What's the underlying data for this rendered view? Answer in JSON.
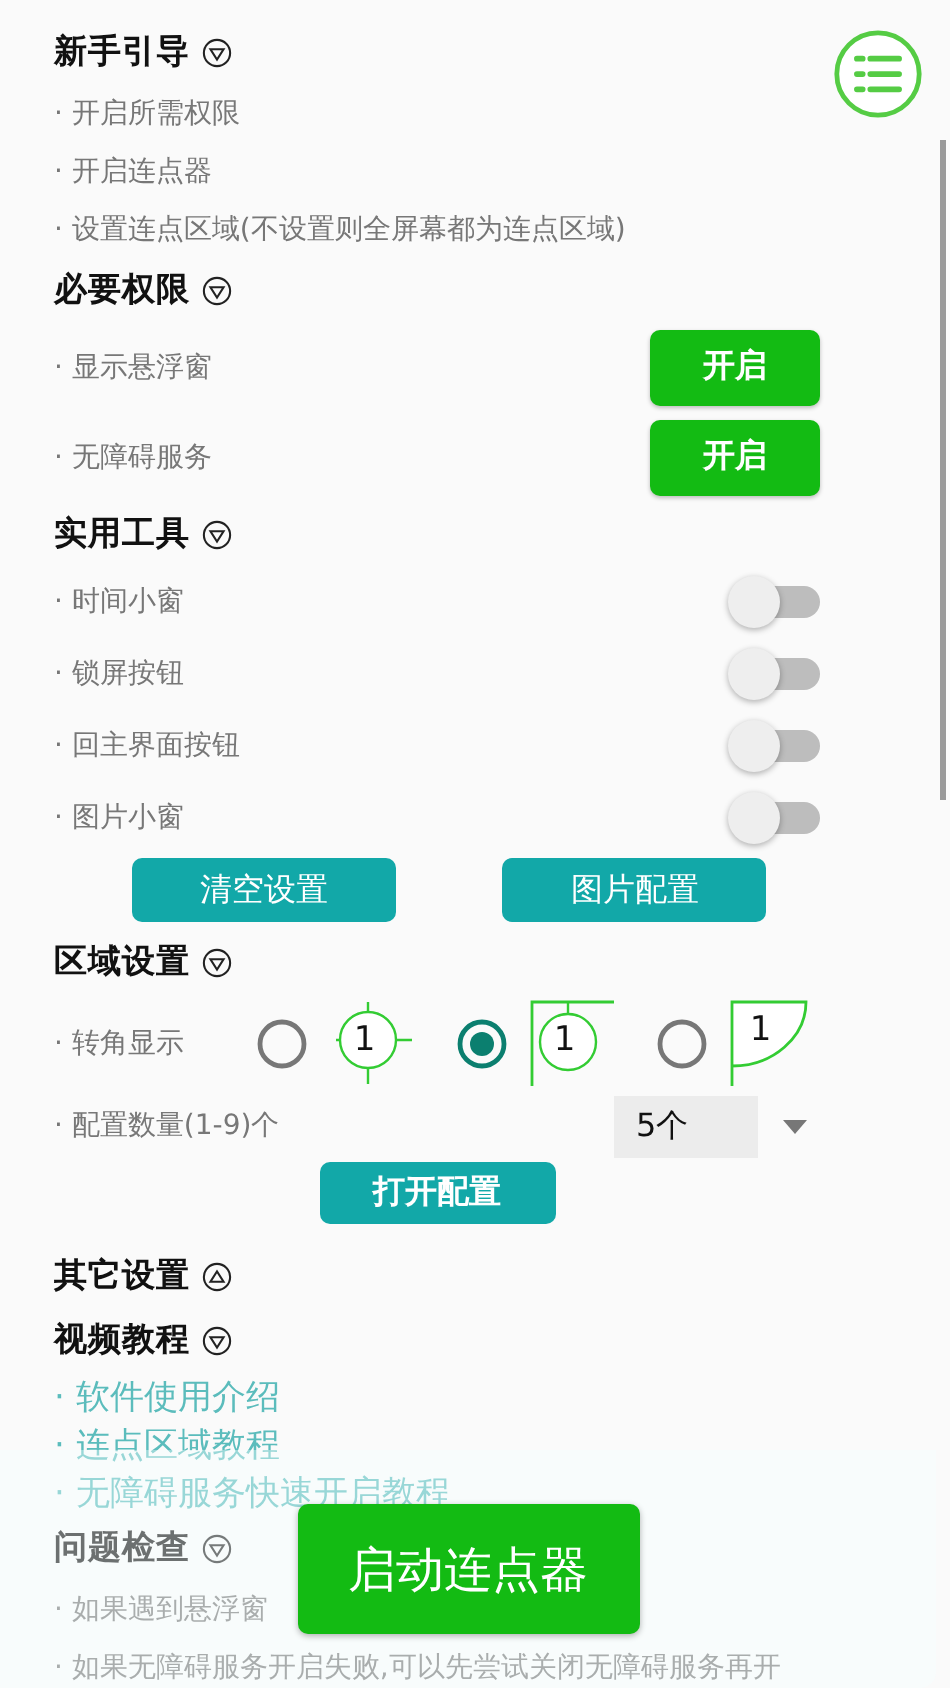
{
  "sections": [
    {
      "kind": "list",
      "title": "新手引导",
      "expanded": true,
      "items": [
        {
          "text": "· 开启所需权限"
        },
        {
          "text": "· 开启连点器"
        },
        {
          "text": "· 设置连点区域(不设置则全屏幕都为连点区域)"
        }
      ]
    },
    {
      "kind": "permissions",
      "title": "必要权限",
      "expanded": true,
      "items": [
        {
          "text": "· 显示悬浮窗",
          "button": "开启"
        },
        {
          "text": "· 无障碍服务",
          "button": "开启"
        }
      ]
    },
    {
      "kind": "toggles",
      "title": "实用工具",
      "expanded": true,
      "items": [
        {
          "text": "· 时间小窗",
          "on": false
        },
        {
          "text": "· 锁屏按钮",
          "on": false
        },
        {
          "text": "· 回主界面按钮",
          "on": false
        },
        {
          "text": "· 图片小窗",
          "on": false
        }
      ],
      "buttons": [
        "清空设置",
        "图片配置"
      ]
    },
    {
      "kind": "area",
      "title": "区域设置",
      "expanded": true,
      "corner": {
        "text": "· 转角显示",
        "options": [
          {
            "kind": "cross",
            "label": "1",
            "selected": false
          },
          {
            "kind": "corner-circle",
            "label": "1",
            "selected": true
          },
          {
            "kind": "quarter",
            "label": "1",
            "selected": false
          }
        ]
      },
      "count": {
        "text": "· 配置数量(1-9)个",
        "value": "5个"
      },
      "button": "打开配置"
    },
    {
      "title": "其它设置",
      "expanded": false
    },
    {
      "kind": "links",
      "title": "视频教程",
      "expanded": true,
      "items": [
        {
          "text": "· 软件使用介绍"
        },
        {
          "text": "· 连点区域教程"
        },
        {
          "text": "· 无障碍服务快速开启教程"
        }
      ]
    },
    {
      "kind": "list",
      "title": "问题检查",
      "expanded": true,
      "items": [
        {
          "text": "· 如果遇到悬浮窗"
        },
        {
          "text": "· 如果无障碍服务开启失败,可以先尝试关闭无障碍服务再开"
        }
      ]
    }
  ],
  "start_button": "启动连点器"
}
